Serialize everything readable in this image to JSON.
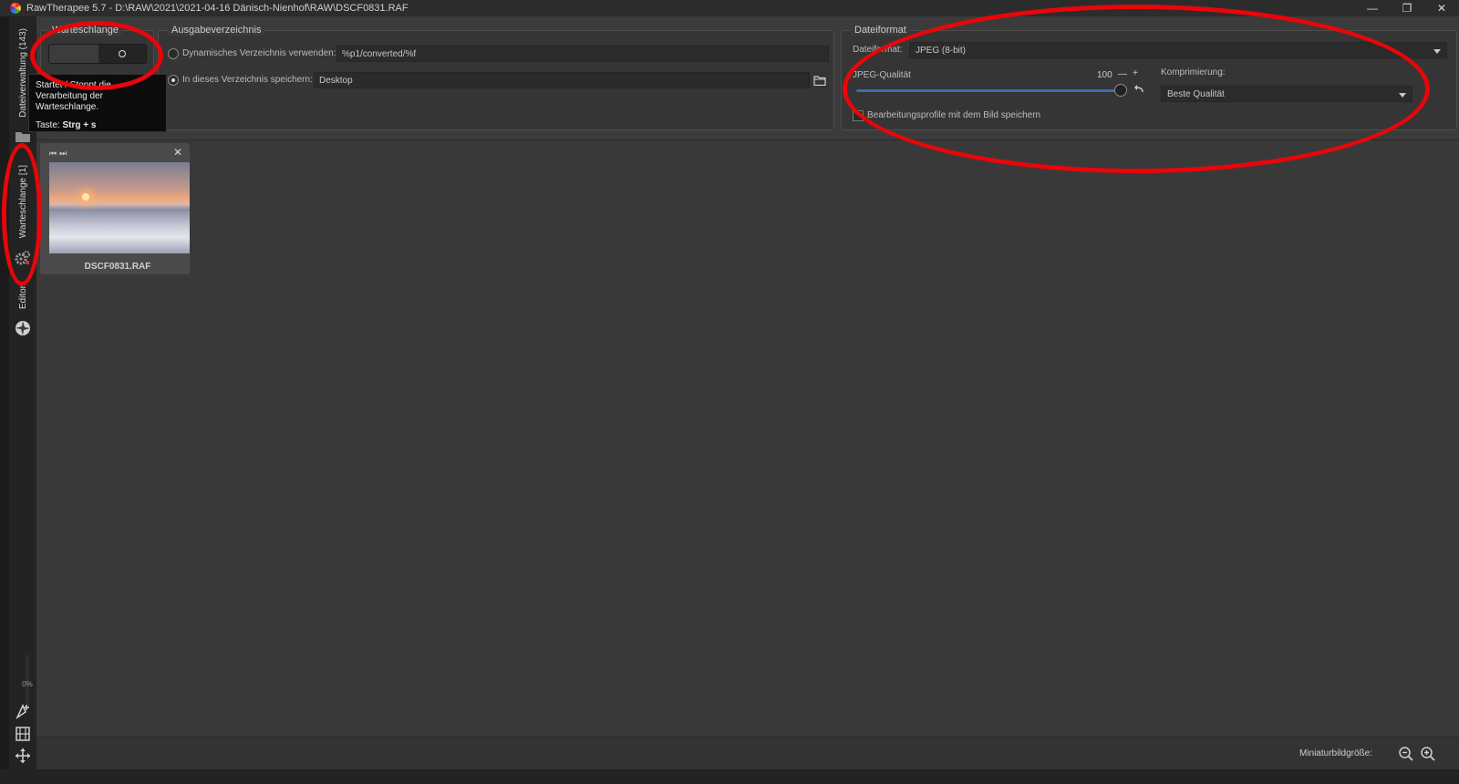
{
  "window": {
    "title": "RawTherapee 5.7 - D:\\RAW\\2021\\2021-04-16 Dänisch-Nienhof\\RAW\\DSCF0831.RAF",
    "minimize": "—",
    "maximize": "❐",
    "close": "✕"
  },
  "sidebar": {
    "tab_file_browser": "Dateiverwaltung (143)",
    "tab_queue": "Warteschlange [1]",
    "tab_editor": "Editor",
    "progress": "0%"
  },
  "queue_panel": {
    "title": "Warteschlange",
    "tooltip_line1": "Startet / Stoppt die Verarbeitung der Warteschlange.",
    "tooltip_key_prefix": "Taste: ",
    "tooltip_key": "Strg + s"
  },
  "output_dir": {
    "title": "Ausgabeverzeichnis",
    "dynamic_label": "Dynamisches Verzeichnis verwenden:",
    "dynamic_value": "%p1/converted/%f",
    "fixed_label": "In dieses Verzeichnis speichern:",
    "fixed_value": "Desktop",
    "selected": "fixed"
  },
  "file_format": {
    "title": "Dateiformat",
    "format_label": "Dateiformat:",
    "format_value": "JPEG (8-bit)",
    "quality_label": "JPEG-Qualität",
    "quality_value": "100",
    "quality_minus": "—",
    "quality_plus": "+",
    "quality_fraction": 1.0,
    "compression_label": "Komprimierung:",
    "compression_value": "Beste Qualität",
    "save_profiles_label": "Bearbeitungsprofile mit dem Bild speichern",
    "save_profiles_checked": false
  },
  "queue_items": [
    {
      "filename": "DSCF0831.RAF",
      "nav": "⏮⏭",
      "close": "✕"
    }
  ],
  "statusbar": {
    "thumb_size_label": "Miniaturbildgröße:"
  },
  "colors": {
    "accent": "#3d6db0",
    "annotation": "#e8060a",
    "background": "#3a3a3a"
  }
}
